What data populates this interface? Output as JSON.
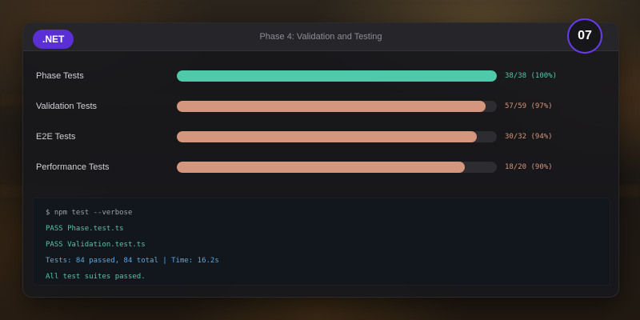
{
  "header": {
    "badge": ".NET",
    "title": "Phase 4: Validation and Testing",
    "step": "07"
  },
  "colors": {
    "accent": "#5b2fd6",
    "pass_bar": "#4ec9a9",
    "partial_bar": "#d4967d",
    "term_prompt": "#9ba0a8",
    "term_pass": "#4ec9a9",
    "term_info": "#5aa9e6"
  },
  "tests": [
    {
      "label": "Phase Tests",
      "value": "38/38 (100%)",
      "passed": 38,
      "total": 38,
      "status": "pass"
    },
    {
      "label": "Validation Tests",
      "value": "57/59 (97%)",
      "passed": 57,
      "total": 59,
      "status": "partial"
    },
    {
      "label": "E2E Tests",
      "value": "30/32 (94%)",
      "passed": 30,
      "total": 32,
      "status": "partial"
    },
    {
      "label": "Performance Tests",
      "value": "18/20 (90%)",
      "passed": 18,
      "total": 20,
      "status": "partial"
    }
  ],
  "terminal": {
    "lines": [
      {
        "text": "$ npm test --verbose",
        "kind": "prompt"
      },
      {
        "text": "PASS Phase.test.ts",
        "kind": "pass"
      },
      {
        "text": "PASS Validation.test.ts",
        "kind": "pass"
      },
      {
        "text": "Tests: 84 passed, 84 total | Time: 16.2s",
        "kind": "info"
      },
      {
        "text": "All test suites passed.",
        "kind": "pass"
      }
    ]
  }
}
